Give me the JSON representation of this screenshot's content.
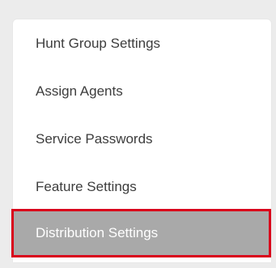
{
  "menu": {
    "items": [
      {
        "label": "Hunt Group Settings"
      },
      {
        "label": "Assign Agents"
      },
      {
        "label": "Service Passwords"
      },
      {
        "label": "Feature Settings"
      },
      {
        "label": "Distribution Settings",
        "selected": true
      }
    ]
  },
  "colors": {
    "page_background": "#ececec",
    "menu_background": "#ffffff",
    "selected_background": "#a9a9a9",
    "selected_highlight_border": "#d9001b",
    "item_text": "#3d3d3d",
    "selected_text": "#ffffff"
  }
}
